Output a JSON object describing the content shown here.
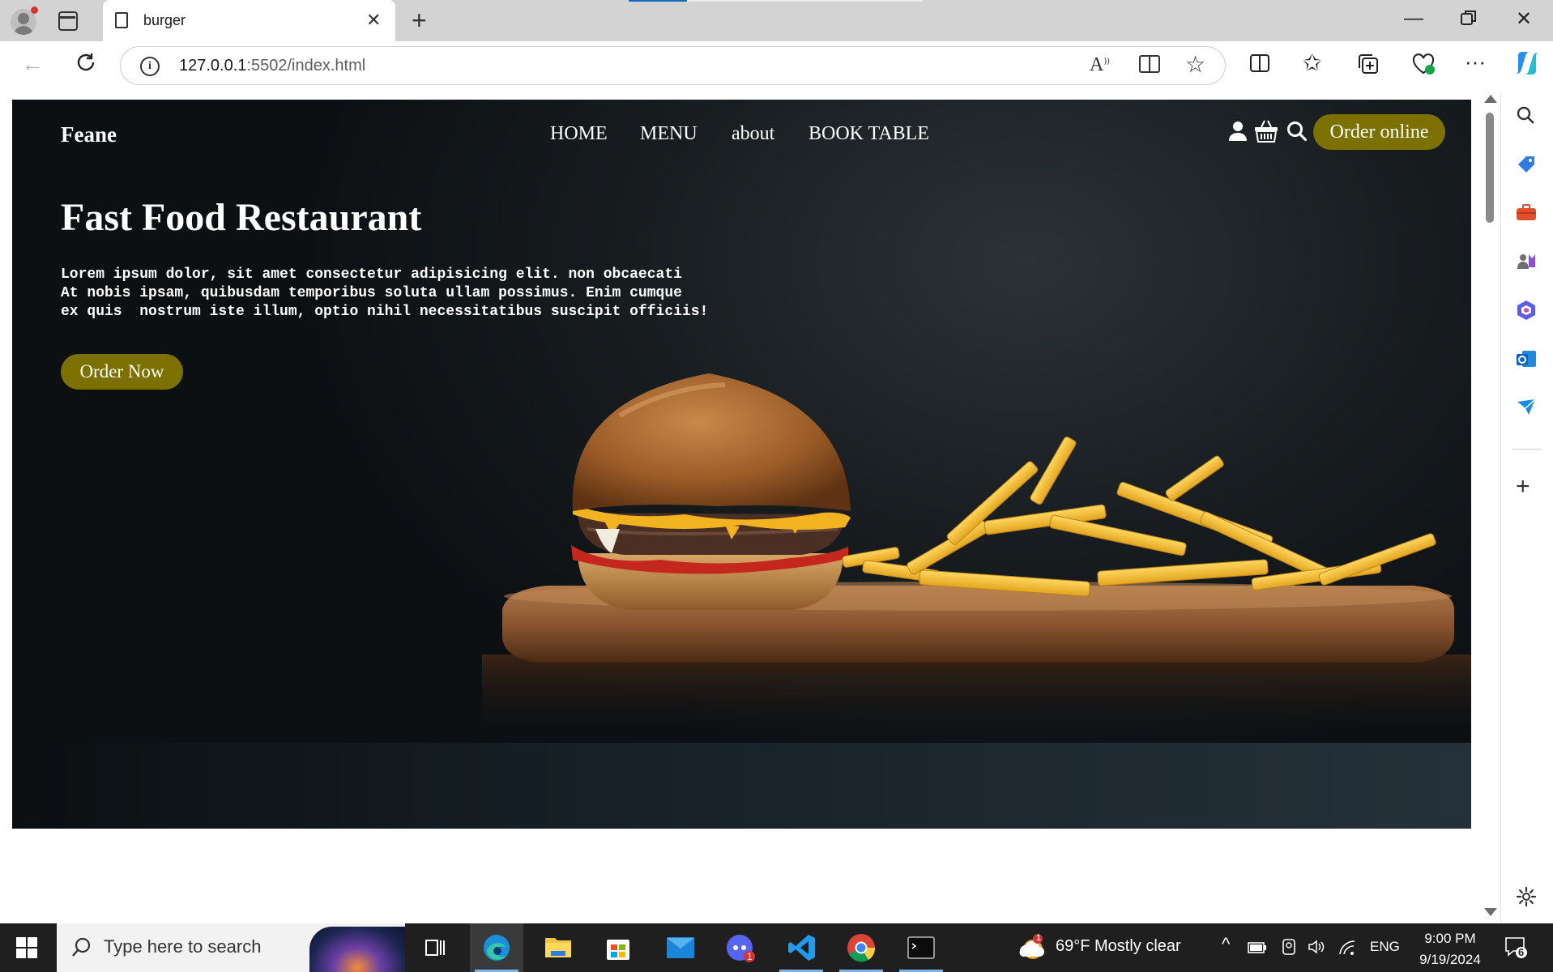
{
  "browser": {
    "tab_title": "burger",
    "url_host": "127.0.0.1",
    "url_rest": ":5502/index.html"
  },
  "site": {
    "brand": "Feane",
    "nav": [
      "HOME",
      "MENU",
      "about",
      "BOOK TABLE"
    ],
    "order_online": "Order online",
    "hero_title": "Fast Food Restaurant",
    "hero_text": "Lorem ipsum dolor, sit amet consectetur adipisicing elit. non obcaecati\nAt nobis ipsam, quibusdam temporibus soluta ullam possimus. Enim cumque\nex quis  nostrum iste illum, optio nihil necessitatibus suscipit officiis!",
    "order_now": "Order Now",
    "accent_color": "#7b7000"
  },
  "taskbar": {
    "search_placeholder": "Type here to search",
    "weather": "69°F  Mostly clear",
    "weather_badge": "1",
    "language": "ENG",
    "time": "9:00 PM",
    "date": "9/19/2024",
    "notifications": "6",
    "discord_badge": "1"
  }
}
